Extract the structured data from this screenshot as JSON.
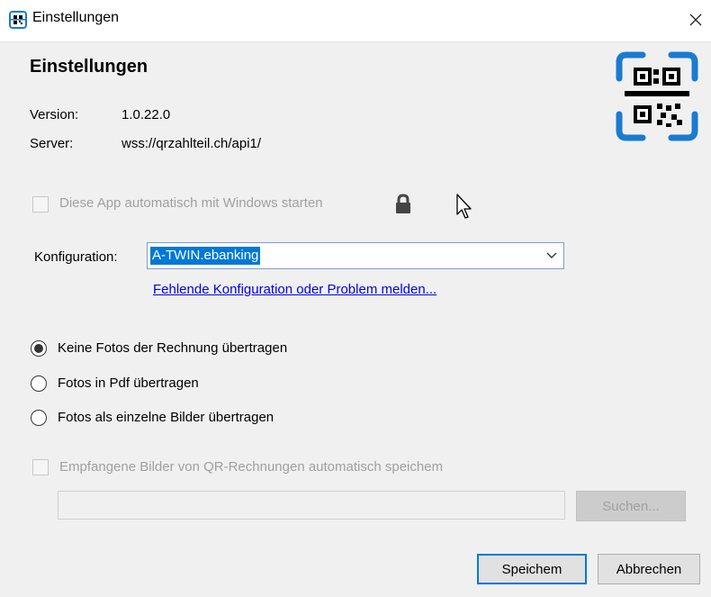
{
  "window": {
    "title": "Einstellungen",
    "close_glyph": "✕"
  },
  "main": {
    "heading": "Einstellungen",
    "version_label": "Version:",
    "version_value": "1.0.22.0",
    "server_label": "Server:",
    "server_value": "wss://qrzahlteil.ch/api1/"
  },
  "autostart": {
    "label": "Diese App automatisch mit Windows starten",
    "checked": false,
    "disabled": true,
    "icon": "lock-icon"
  },
  "config": {
    "label": "Konfiguration:",
    "selected": "A-TWIN.ebanking",
    "link": "Fehlende Konfiguration oder Problem melden..."
  },
  "photo_options": [
    {
      "label": "Keine Fotos der Rechnung übertragen",
      "selected": true
    },
    {
      "label": "Fotos in Pdf übertragen",
      "selected": false
    },
    {
      "label": "Fotos als einzelne Bilder übertragen",
      "selected": false
    }
  ],
  "save_images": {
    "label": "Empfangene Bilder von QR-Rechnungen automatisch speichem",
    "checked": false,
    "disabled": true
  },
  "path_field": {
    "value": ""
  },
  "buttons": {
    "search": "Suchen...",
    "save": "Speichem",
    "cancel": "Abbrechen"
  },
  "colors": {
    "accent": "#0078d7",
    "link": "#0000ee",
    "disabled_text": "#a0a0a0",
    "logo_blue": "#1a7bd0"
  }
}
